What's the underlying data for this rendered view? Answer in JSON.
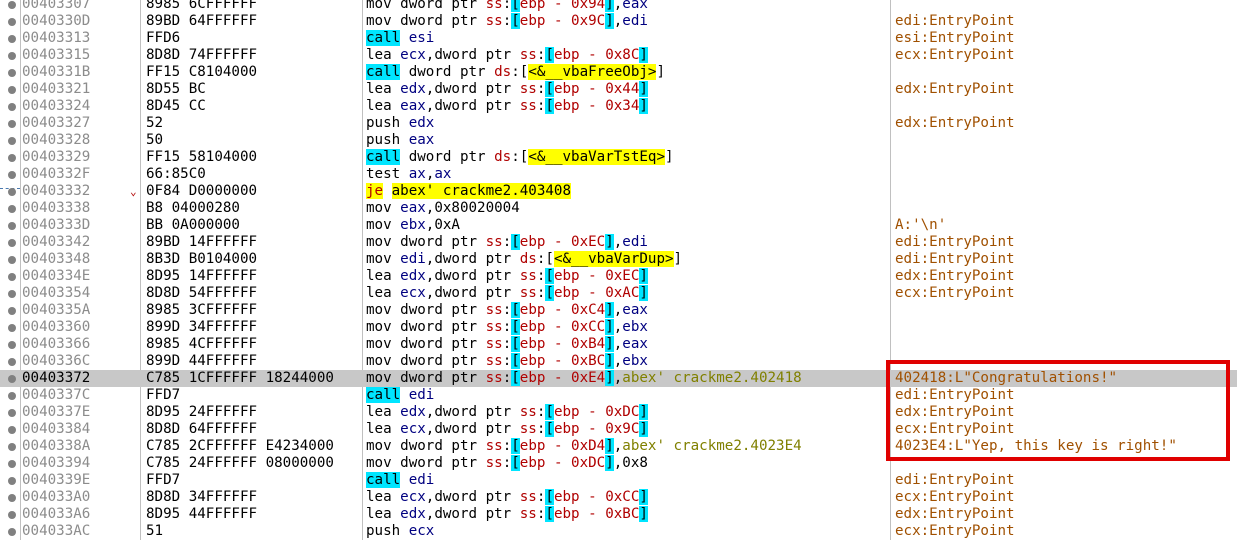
{
  "rows": [
    {
      "addr": "00403307",
      "bytes": "8985 6CFFFFFF",
      "instr": [
        {
          "t": "mov ",
          "c": ""
        },
        {
          "t": "dword ptr ",
          "c": ""
        },
        {
          "t": "ss",
          "c": "seg"
        },
        {
          "t": ":",
          "c": ""
        },
        {
          "t": "[",
          "c": "brk"
        },
        {
          "t": "ebp - 0x94",
          "c": "off"
        },
        {
          "t": "]",
          "c": "brk"
        },
        {
          "t": ",",
          "c": ""
        },
        {
          "t": "eax",
          "c": "reg"
        }
      ],
      "comment": ""
    },
    {
      "addr": "0040330D",
      "bytes": "89BD 64FFFFFF",
      "instr": [
        {
          "t": "mov ",
          "c": ""
        },
        {
          "t": "dword ptr ",
          "c": ""
        },
        {
          "t": "ss",
          "c": "seg"
        },
        {
          "t": ":",
          "c": ""
        },
        {
          "t": "[",
          "c": "brk"
        },
        {
          "t": "ebp - 0x9C",
          "c": "off"
        },
        {
          "t": "]",
          "c": "brk"
        },
        {
          "t": ",",
          "c": ""
        },
        {
          "t": "edi",
          "c": "reg"
        }
      ],
      "comment": "edi:EntryPoint"
    },
    {
      "addr": "00403313",
      "bytes": "FFD6",
      "instr": [
        {
          "t": "call",
          "c": "call"
        },
        {
          "t": " ",
          "c": ""
        },
        {
          "t": "esi",
          "c": "reg"
        }
      ],
      "comment": "esi:EntryPoint"
    },
    {
      "addr": "00403315",
      "bytes": "8D8D 74FFFFFF",
      "instr": [
        {
          "t": "lea ",
          "c": ""
        },
        {
          "t": "ecx",
          "c": "reg"
        },
        {
          "t": ",dword ptr ",
          "c": ""
        },
        {
          "t": "ss",
          "c": "seg"
        },
        {
          "t": ":",
          "c": ""
        },
        {
          "t": "[",
          "c": "brk"
        },
        {
          "t": "ebp - 0x8C",
          "c": "off"
        },
        {
          "t": "]",
          "c": "brk"
        }
      ],
      "comment": "ecx:EntryPoint"
    },
    {
      "addr": "0040331B",
      "bytes": "FF15 C8104000",
      "instr": [
        {
          "t": "call",
          "c": "call"
        },
        {
          "t": " dword ptr ",
          "c": ""
        },
        {
          "t": "ds",
          "c": "seg"
        },
        {
          "t": ":[",
          "c": ""
        },
        {
          "t": "<&__vbaFreeObj>",
          "c": "lbl"
        },
        {
          "t": "]",
          "c": ""
        }
      ],
      "comment": ""
    },
    {
      "addr": "00403321",
      "bytes": "8D55 BC",
      "instr": [
        {
          "t": "lea ",
          "c": ""
        },
        {
          "t": "edx",
          "c": "reg"
        },
        {
          "t": ",dword ptr ",
          "c": ""
        },
        {
          "t": "ss",
          "c": "seg"
        },
        {
          "t": ":",
          "c": ""
        },
        {
          "t": "[",
          "c": "brk"
        },
        {
          "t": "ebp - 0x44",
          "c": "off"
        },
        {
          "t": "]",
          "c": "brk"
        }
      ],
      "comment": "edx:EntryPoint"
    },
    {
      "addr": "00403324",
      "bytes": "8D45 CC",
      "instr": [
        {
          "t": "lea ",
          "c": ""
        },
        {
          "t": "eax",
          "c": "reg"
        },
        {
          "t": ",dword ptr ",
          "c": ""
        },
        {
          "t": "ss",
          "c": "seg"
        },
        {
          "t": ":",
          "c": ""
        },
        {
          "t": "[",
          "c": "brk"
        },
        {
          "t": "ebp - 0x34",
          "c": "off"
        },
        {
          "t": "]",
          "c": "brk"
        }
      ],
      "comment": ""
    },
    {
      "addr": "00403327",
      "bytes": "52",
      "instr": [
        {
          "t": "push ",
          "c": ""
        },
        {
          "t": "edx",
          "c": "reg"
        }
      ],
      "comment": "edx:EntryPoint"
    },
    {
      "addr": "00403328",
      "bytes": "50",
      "instr": [
        {
          "t": "push ",
          "c": ""
        },
        {
          "t": "eax",
          "c": "reg"
        }
      ],
      "comment": ""
    },
    {
      "addr": "00403329",
      "bytes": "FF15 58104000",
      "instr": [
        {
          "t": "call",
          "c": "call"
        },
        {
          "t": " dword ptr ",
          "c": ""
        },
        {
          "t": "ds",
          "c": "seg"
        },
        {
          "t": ":[",
          "c": ""
        },
        {
          "t": "<&__vbaVarTstEq>",
          "c": "lbl"
        },
        {
          "t": "]",
          "c": ""
        }
      ],
      "comment": ""
    },
    {
      "addr": "0040332F",
      "bytes": "66:85C0",
      "instr": [
        {
          "t": "test ",
          "c": ""
        },
        {
          "t": "ax",
          "c": "reg"
        },
        {
          "t": ",",
          "c": ""
        },
        {
          "t": "ax",
          "c": "reg"
        }
      ],
      "comment": ""
    },
    {
      "addr": "00403332",
      "bytes": "0F84 D0000000",
      "arrow": true,
      "instr": [
        {
          "t": "je",
          "c": "jmp"
        },
        {
          "t": " ",
          "c": ""
        },
        {
          "t": "abex' crackme2.403408",
          "c": "lbl"
        }
      ],
      "comment": ""
    },
    {
      "addr": "00403338",
      "bytes": "B8 04000280",
      "instr": [
        {
          "t": "mov ",
          "c": ""
        },
        {
          "t": "eax",
          "c": "reg"
        },
        {
          "t": ",0x80020004",
          "c": ""
        }
      ],
      "comment": ""
    },
    {
      "addr": "0040333D",
      "bytes": "BB 0A000000",
      "instr": [
        {
          "t": "mov ",
          "c": ""
        },
        {
          "t": "ebx",
          "c": "reg"
        },
        {
          "t": ",0xA",
          "c": ""
        }
      ],
      "comment": "A:'\\n'"
    },
    {
      "addr": "00403342",
      "bytes": "89BD 14FFFFFF",
      "instr": [
        {
          "t": "mov ",
          "c": ""
        },
        {
          "t": "dword ptr ",
          "c": ""
        },
        {
          "t": "ss",
          "c": "seg"
        },
        {
          "t": ":",
          "c": ""
        },
        {
          "t": "[",
          "c": "brk"
        },
        {
          "t": "ebp - 0xEC",
          "c": "off"
        },
        {
          "t": "]",
          "c": "brk"
        },
        {
          "t": ",",
          "c": ""
        },
        {
          "t": "edi",
          "c": "reg"
        }
      ],
      "comment": "edi:EntryPoint"
    },
    {
      "addr": "00403348",
      "bytes": "8B3D B0104000",
      "instr": [
        {
          "t": "mov ",
          "c": ""
        },
        {
          "t": "edi",
          "c": "reg"
        },
        {
          "t": ",dword ptr ",
          "c": ""
        },
        {
          "t": "ds",
          "c": "seg"
        },
        {
          "t": ":[",
          "c": ""
        },
        {
          "t": "<&__vbaVarDup>",
          "c": "lbl"
        },
        {
          "t": "]",
          "c": ""
        }
      ],
      "comment": "edi:EntryPoint"
    },
    {
      "addr": "0040334E",
      "bytes": "8D95 14FFFFFF",
      "instr": [
        {
          "t": "lea ",
          "c": ""
        },
        {
          "t": "edx",
          "c": "reg"
        },
        {
          "t": ",dword ptr ",
          "c": ""
        },
        {
          "t": "ss",
          "c": "seg"
        },
        {
          "t": ":",
          "c": ""
        },
        {
          "t": "[",
          "c": "brk"
        },
        {
          "t": "ebp - 0xEC",
          "c": "off"
        },
        {
          "t": "]",
          "c": "brk"
        }
      ],
      "comment": "edx:EntryPoint"
    },
    {
      "addr": "00403354",
      "bytes": "8D8D 54FFFFFF",
      "instr": [
        {
          "t": "lea ",
          "c": ""
        },
        {
          "t": "ecx",
          "c": "reg"
        },
        {
          "t": ",dword ptr ",
          "c": ""
        },
        {
          "t": "ss",
          "c": "seg"
        },
        {
          "t": ":",
          "c": ""
        },
        {
          "t": "[",
          "c": "brk"
        },
        {
          "t": "ebp - 0xAC",
          "c": "off"
        },
        {
          "t": "]",
          "c": "brk"
        }
      ],
      "comment": "ecx:EntryPoint"
    },
    {
      "addr": "0040335A",
      "bytes": "8985 3CFFFFFF",
      "instr": [
        {
          "t": "mov ",
          "c": ""
        },
        {
          "t": "dword ptr ",
          "c": ""
        },
        {
          "t": "ss",
          "c": "seg"
        },
        {
          "t": ":",
          "c": ""
        },
        {
          "t": "[",
          "c": "brk"
        },
        {
          "t": "ebp - 0xC4",
          "c": "off"
        },
        {
          "t": "]",
          "c": "brk"
        },
        {
          "t": ",",
          "c": ""
        },
        {
          "t": "eax",
          "c": "reg"
        }
      ],
      "comment": ""
    },
    {
      "addr": "00403360",
      "bytes": "899D 34FFFFFF",
      "instr": [
        {
          "t": "mov ",
          "c": ""
        },
        {
          "t": "dword ptr ",
          "c": ""
        },
        {
          "t": "ss",
          "c": "seg"
        },
        {
          "t": ":",
          "c": ""
        },
        {
          "t": "[",
          "c": "brk"
        },
        {
          "t": "ebp - 0xCC",
          "c": "off"
        },
        {
          "t": "]",
          "c": "brk"
        },
        {
          "t": ",",
          "c": ""
        },
        {
          "t": "ebx",
          "c": "reg"
        }
      ],
      "comment": ""
    },
    {
      "addr": "00403366",
      "bytes": "8985 4CFFFFFF",
      "instr": [
        {
          "t": "mov ",
          "c": ""
        },
        {
          "t": "dword ptr ",
          "c": ""
        },
        {
          "t": "ss",
          "c": "seg"
        },
        {
          "t": ":",
          "c": ""
        },
        {
          "t": "[",
          "c": "brk"
        },
        {
          "t": "ebp - 0xB4",
          "c": "off"
        },
        {
          "t": "]",
          "c": "brk"
        },
        {
          "t": ",",
          "c": ""
        },
        {
          "t": "eax",
          "c": "reg"
        }
      ],
      "comment": ""
    },
    {
      "addr": "0040336C",
      "bytes": "899D 44FFFFFF",
      "instr": [
        {
          "t": "mov ",
          "c": ""
        },
        {
          "t": "dword ptr ",
          "c": ""
        },
        {
          "t": "ss",
          "c": "seg"
        },
        {
          "t": ":",
          "c": ""
        },
        {
          "t": "[",
          "c": "brk"
        },
        {
          "t": "ebp - 0xBC",
          "c": "off"
        },
        {
          "t": "]",
          "c": "brk"
        },
        {
          "t": ",",
          "c": ""
        },
        {
          "t": "ebx",
          "c": "reg"
        }
      ],
      "comment": ""
    },
    {
      "addr": "00403372",
      "bytes": "C785 1CFFFFFF 18244000",
      "hl": true,
      "instr": [
        {
          "t": "mov ",
          "c": ""
        },
        {
          "t": "dword ptr ",
          "c": ""
        },
        {
          "t": "ss",
          "c": "seg"
        },
        {
          "t": ":",
          "c": ""
        },
        {
          "t": "[",
          "c": "brk"
        },
        {
          "t": "ebp - 0xE4",
          "c": "off"
        },
        {
          "t": "]",
          "c": "brk"
        },
        {
          "t": ",",
          "c": ""
        },
        {
          "t": "abex' crackme2.402418",
          "c": "lbltxt"
        }
      ],
      "comment": "402418:L\"Congratulations!\""
    },
    {
      "addr": "0040337C",
      "bytes": "FFD7",
      "instr": [
        {
          "t": "call",
          "c": "call"
        },
        {
          "t": " ",
          "c": ""
        },
        {
          "t": "edi",
          "c": "reg"
        }
      ],
      "comment": "edi:EntryPoint"
    },
    {
      "addr": "0040337E",
      "bytes": "8D95 24FFFFFF",
      "instr": [
        {
          "t": "lea ",
          "c": ""
        },
        {
          "t": "edx",
          "c": "reg"
        },
        {
          "t": ",dword ptr ",
          "c": ""
        },
        {
          "t": "ss",
          "c": "seg"
        },
        {
          "t": ":",
          "c": ""
        },
        {
          "t": "[",
          "c": "brk"
        },
        {
          "t": "ebp - 0xDC",
          "c": "off"
        },
        {
          "t": "]",
          "c": "brk"
        }
      ],
      "comment": "edx:EntryPoint"
    },
    {
      "addr": "00403384",
      "bytes": "8D8D 64FFFFFF",
      "instr": [
        {
          "t": "lea ",
          "c": ""
        },
        {
          "t": "ecx",
          "c": "reg"
        },
        {
          "t": ",dword ptr ",
          "c": ""
        },
        {
          "t": "ss",
          "c": "seg"
        },
        {
          "t": ":",
          "c": ""
        },
        {
          "t": "[",
          "c": "brk"
        },
        {
          "t": "ebp - 0x9C",
          "c": "off"
        },
        {
          "t": "]",
          "c": "brk"
        }
      ],
      "comment": "ecx:EntryPoint"
    },
    {
      "addr": "0040338A",
      "bytes": "C785 2CFFFFFF E4234000",
      "instr": [
        {
          "t": "mov ",
          "c": ""
        },
        {
          "t": "dword ptr ",
          "c": ""
        },
        {
          "t": "ss",
          "c": "seg"
        },
        {
          "t": ":",
          "c": ""
        },
        {
          "t": "[",
          "c": "brk"
        },
        {
          "t": "ebp - 0xD4",
          "c": "off"
        },
        {
          "t": "]",
          "c": "brk"
        },
        {
          "t": ",",
          "c": ""
        },
        {
          "t": "abex' crackme2.4023E4",
          "c": "lbltxt"
        }
      ],
      "comment": "4023E4:L\"Yep, this key is right!\""
    },
    {
      "addr": "00403394",
      "bytes": "C785 24FFFFFF 08000000",
      "instr": [
        {
          "t": "mov ",
          "c": ""
        },
        {
          "t": "dword ptr ",
          "c": ""
        },
        {
          "t": "ss",
          "c": "seg"
        },
        {
          "t": ":",
          "c": ""
        },
        {
          "t": "[",
          "c": "brk"
        },
        {
          "t": "ebp - 0xDC",
          "c": "off"
        },
        {
          "t": "]",
          "c": "brk"
        },
        {
          "t": ",0x8",
          "c": ""
        }
      ],
      "comment": ""
    },
    {
      "addr": "0040339E",
      "bytes": "FFD7",
      "instr": [
        {
          "t": "call",
          "c": "call"
        },
        {
          "t": " ",
          "c": ""
        },
        {
          "t": "edi",
          "c": "reg"
        }
      ],
      "comment": "edi:EntryPoint"
    },
    {
      "addr": "004033A0",
      "bytes": "8D8D 34FFFFFF",
      "instr": [
        {
          "t": "lea ",
          "c": ""
        },
        {
          "t": "ecx",
          "c": "reg"
        },
        {
          "t": ",dword ptr ",
          "c": ""
        },
        {
          "t": "ss",
          "c": "seg"
        },
        {
          "t": ":",
          "c": ""
        },
        {
          "t": "[",
          "c": "brk"
        },
        {
          "t": "ebp - 0xCC",
          "c": "off"
        },
        {
          "t": "]",
          "c": "brk"
        }
      ],
      "comment": "ecx:EntryPoint"
    },
    {
      "addr": "004033A6",
      "bytes": "8D95 44FFFFFF",
      "instr": [
        {
          "t": "lea ",
          "c": ""
        },
        {
          "t": "edx",
          "c": "reg"
        },
        {
          "t": ",dword ptr ",
          "c": ""
        },
        {
          "t": "ss",
          "c": "seg"
        },
        {
          "t": ":",
          "c": ""
        },
        {
          "t": "[",
          "c": "brk"
        },
        {
          "t": "ebp - 0xBC",
          "c": "off"
        },
        {
          "t": "]",
          "c": "brk"
        }
      ],
      "comment": "edx:EntryPoint"
    },
    {
      "addr": "004033AC",
      "bytes": "51",
      "instr": [
        {
          "t": "push ",
          "c": ""
        },
        {
          "t": "ecx",
          "c": "reg"
        }
      ],
      "comment": "ecx:EntryPoint"
    }
  ]
}
